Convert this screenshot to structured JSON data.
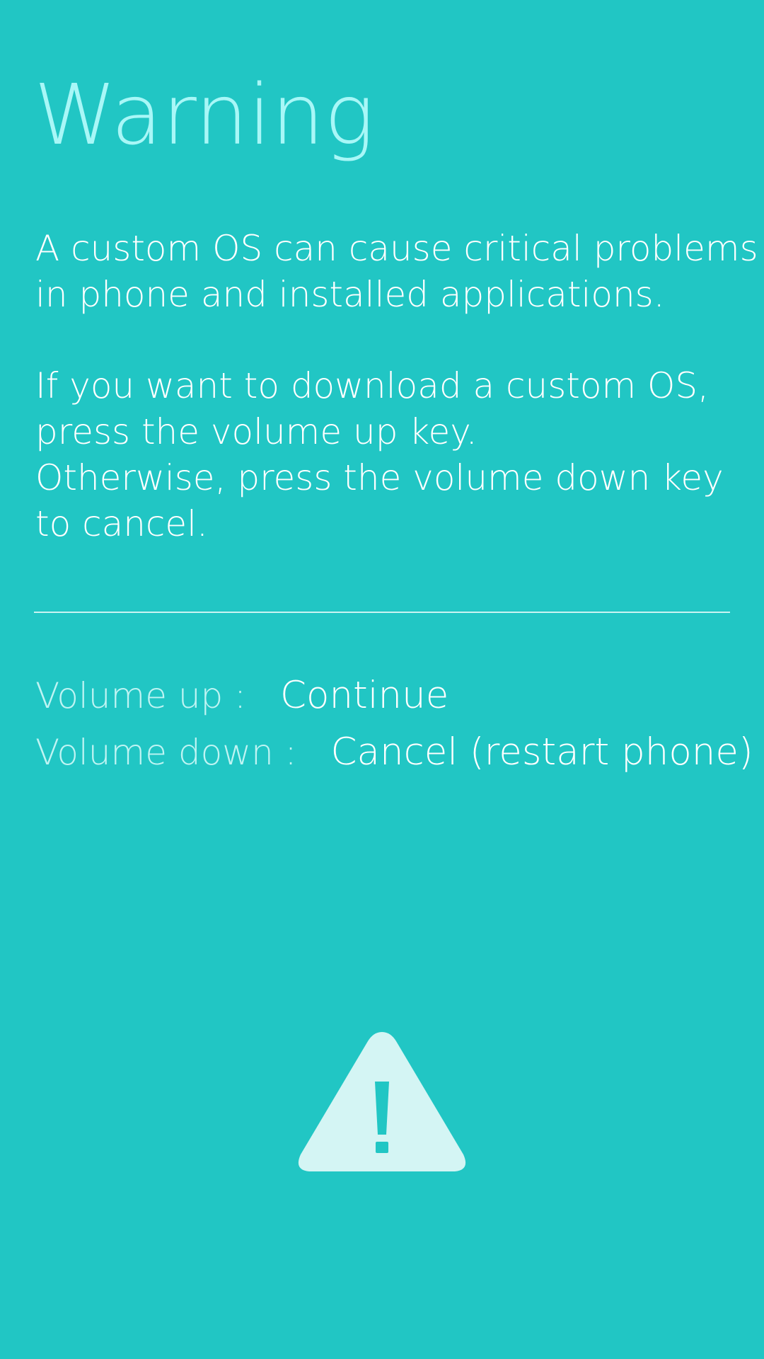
{
  "title": "Warning",
  "message": {
    "paragraph1": [
      "A custom OS can cause critical problems",
      "in phone and installed applications."
    ],
    "paragraph2": [
      "If you want to download a custom OS,",
      "press the volume up key.",
      "Otherwise, press the volume down key",
      "to cancel."
    ]
  },
  "keys": {
    "volume_up": {
      "label": "Volume up :",
      "action": "Continue"
    },
    "volume_down": {
      "label": "Volume down :",
      "action": "Cancel (restart phone)"
    }
  },
  "icon": "warning-triangle-icon",
  "colors": {
    "background": "#21c6c4",
    "title": "#a8f7f7",
    "text": "#ffffff",
    "key_label": "#bff4f3",
    "icon": "#d4f5f4"
  }
}
